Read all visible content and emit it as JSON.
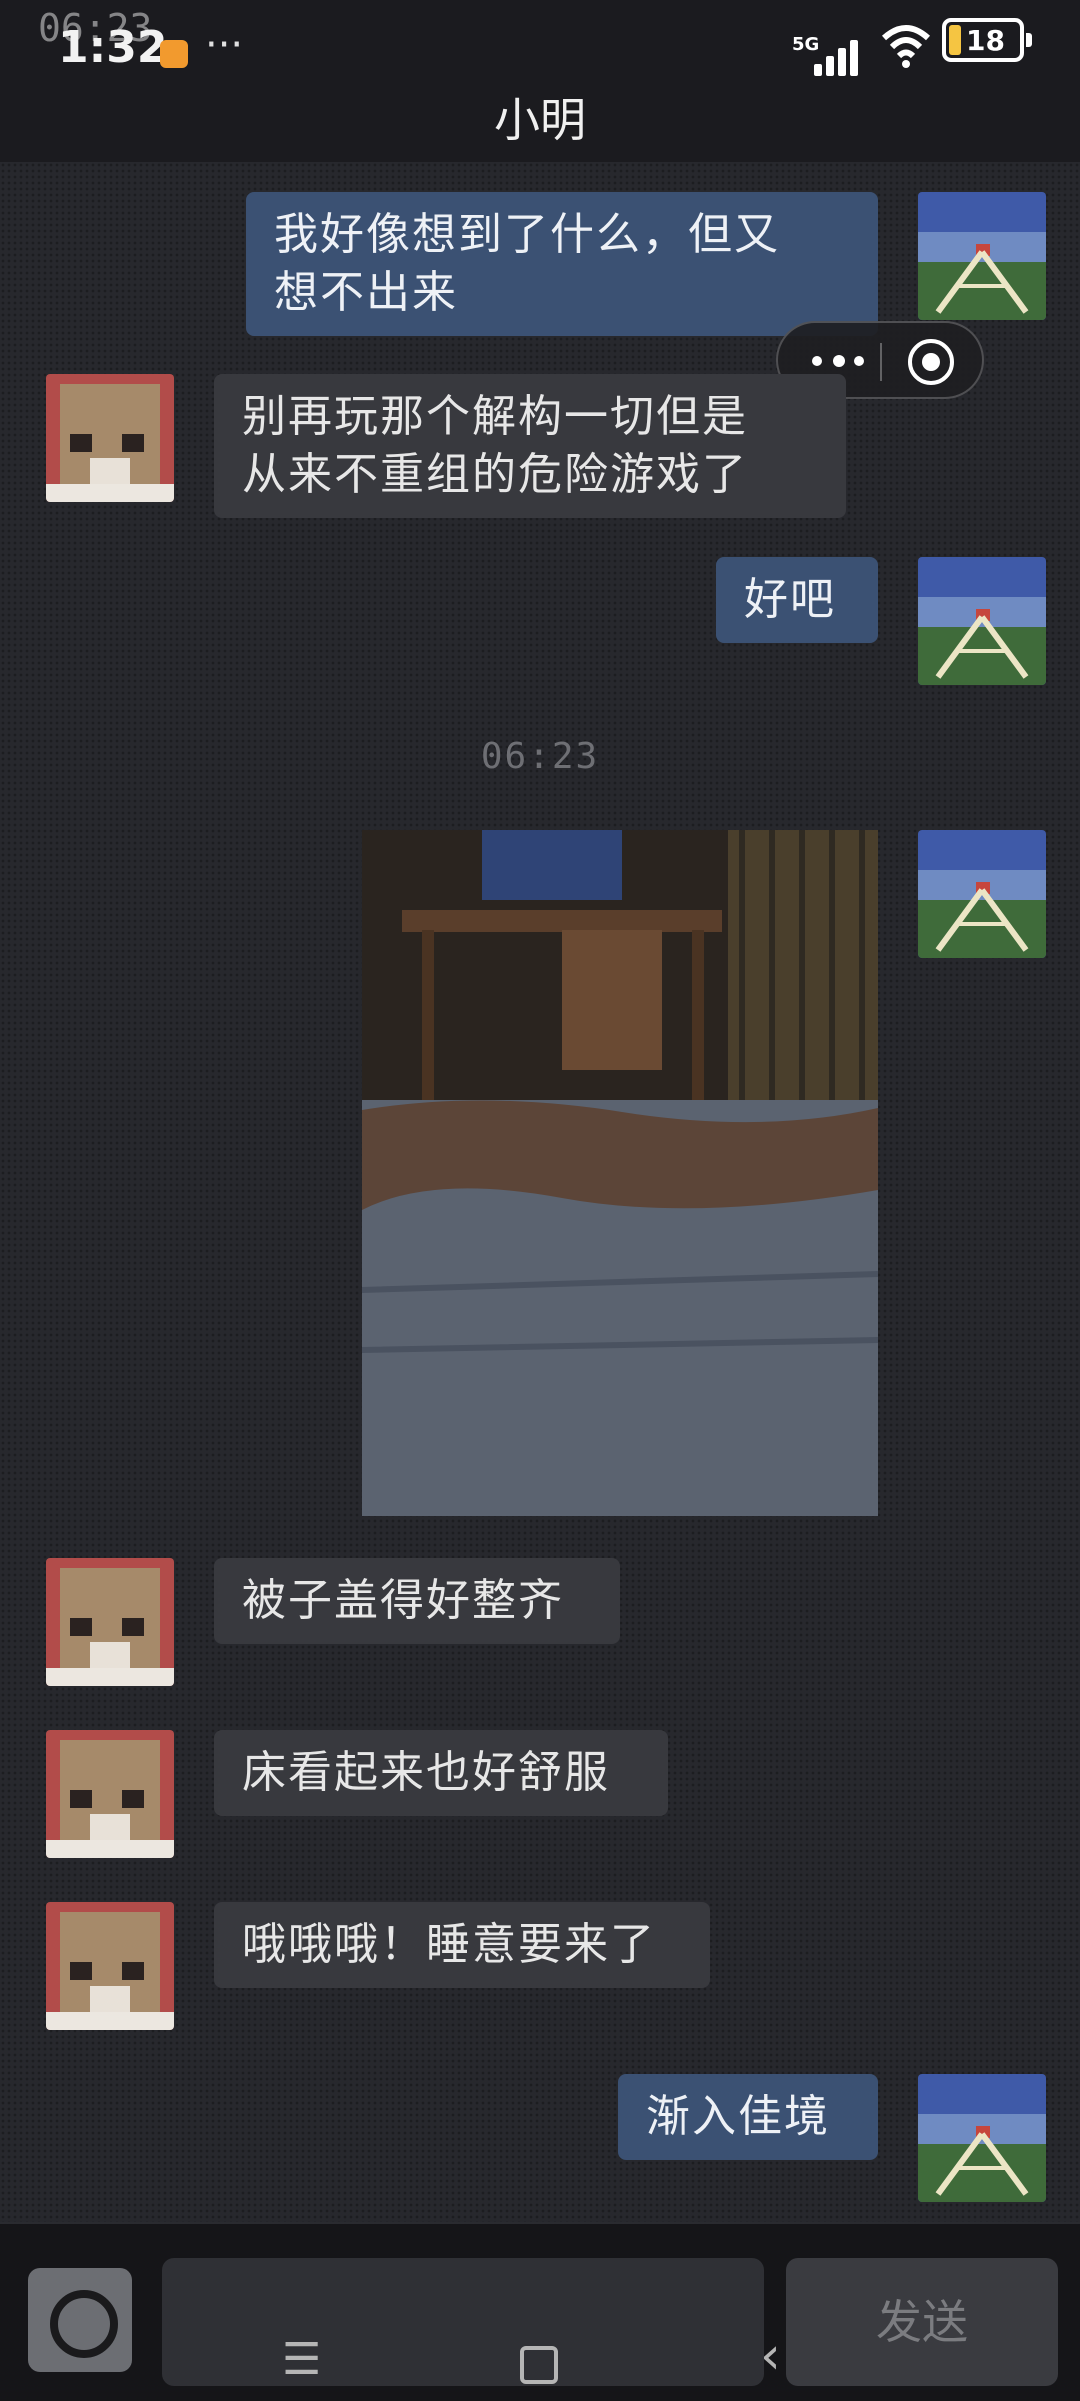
{
  "status_bar": {
    "time": "1:32",
    "overlay_time": "06:23",
    "more": "···",
    "network": "5G",
    "battery": "18"
  },
  "header": {
    "title": "小明"
  },
  "messages": [
    {
      "direction": "out",
      "text": "我好像想到了什么，但又\n想不出来"
    },
    {
      "direction": "in",
      "text": "别再玩那个解构一切但是\n从来不重组的危险游戏了"
    },
    {
      "direction": "out",
      "text": "好吧"
    },
    {
      "direction": "in",
      "text": "被子盖得好整齐"
    },
    {
      "direction": "in",
      "text": "床看起来也好舒服"
    },
    {
      "direction": "in",
      "text": "哦哦哦！睡意要来了"
    },
    {
      "direction": "out",
      "text": "渐入佳境"
    }
  ],
  "timestamp": "06:23",
  "input_bar": {
    "send_label": "发送"
  },
  "colors": {
    "outgoing_bubble": "#3b5173",
    "incoming_bubble": "#38393e",
    "background": "#27282d"
  }
}
